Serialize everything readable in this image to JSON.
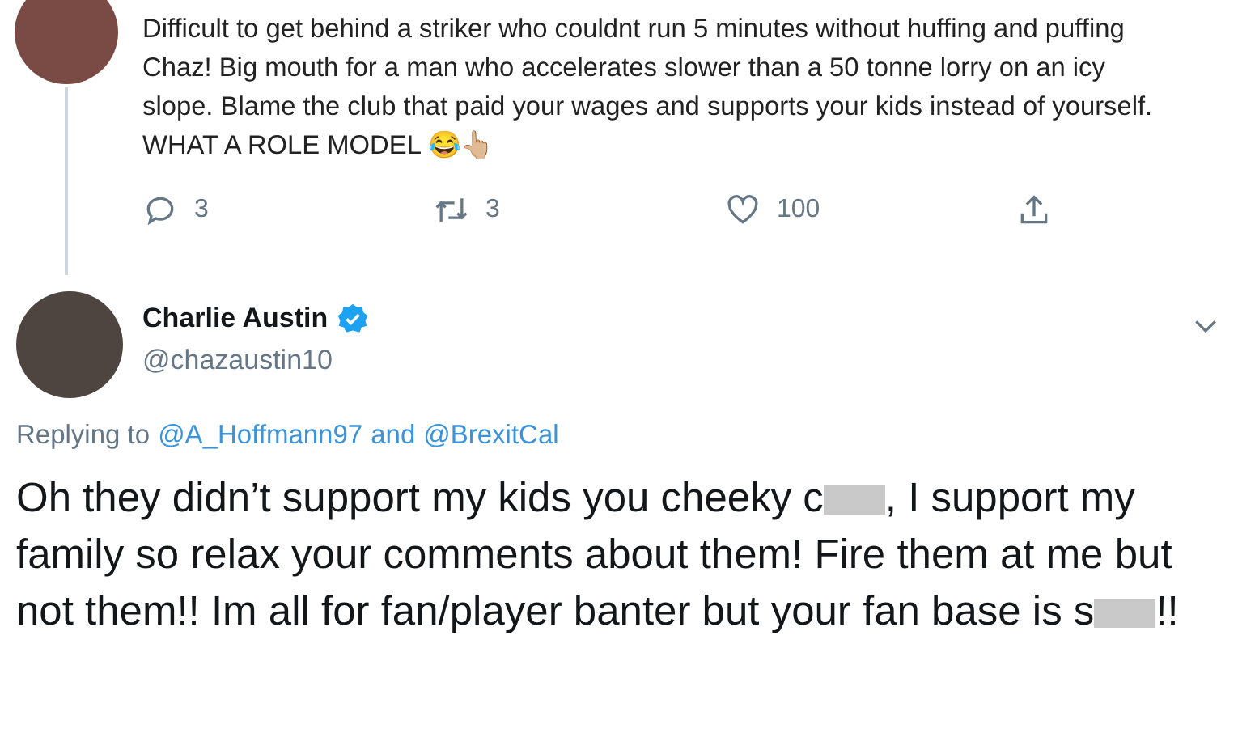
{
  "parent_tweet": {
    "text": "Difficult to get behind a striker who couldnt run 5 minutes without huffing and puffing Chaz! Big mouth for a man who accelerates slower than a 50 tonne lorry on an icy slope. Blame the club that paid your wages and supports your kids instead of yourself. WHAT A ROLE MODEL 😂👆🏼",
    "actions": [
      {
        "kind": "reply",
        "count": "3"
      },
      {
        "kind": "retweet",
        "count": "3"
      },
      {
        "kind": "like",
        "count": "100"
      },
      {
        "kind": "share"
      }
    ]
  },
  "reply_tweet": {
    "name": "Charlie Austin",
    "verified": true,
    "handle": "@chazaustin10",
    "replying_prefix": "Replying to",
    "replying_to": [
      {
        "handle": "@A_Hoffmann97"
      },
      {
        "handle": "@BrexitCal"
      }
    ],
    "replying_joiner": "and",
    "body": [
      {
        "kind": "text",
        "text": "Oh they didn’t support my kids you cheeky c"
      },
      {
        "kind": "censor"
      },
      {
        "kind": "text",
        "text": ", I support my family so relax your comments about them! Fire them at me but not them!! Im all for fan/player banter but your fan base is s"
      },
      {
        "kind": "censor"
      },
      {
        "kind": "text",
        "text": "!!"
      }
    ]
  }
}
